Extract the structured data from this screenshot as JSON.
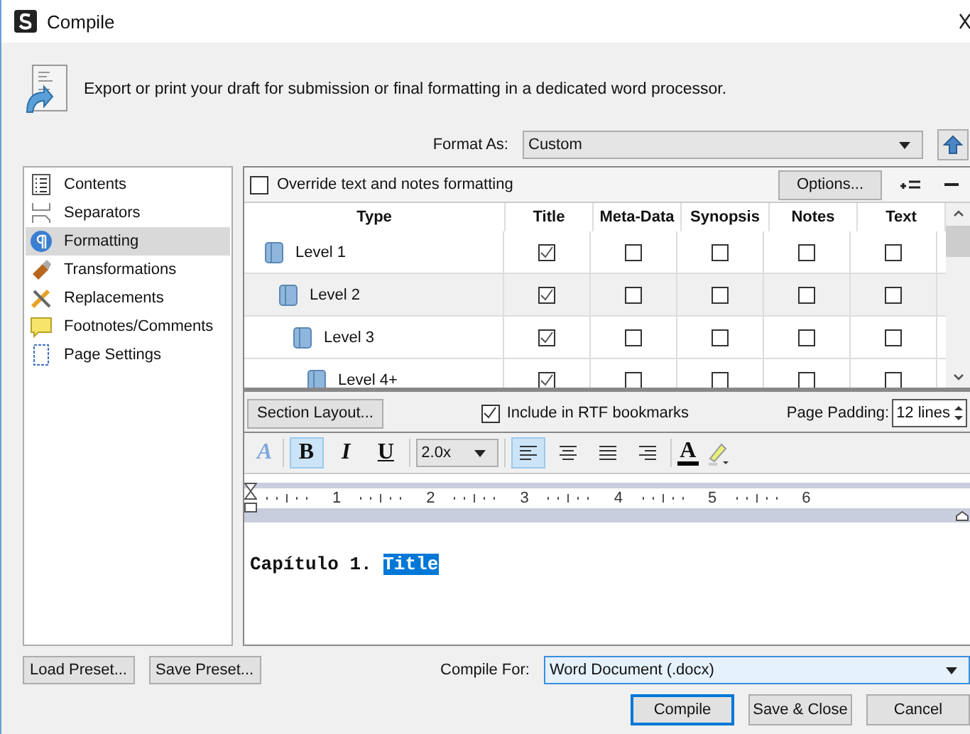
{
  "window": {
    "title": "Compile"
  },
  "header": {
    "description": "Export or print your draft for submission or final formatting in a dedicated word processor."
  },
  "format_as": {
    "label": "Format As:",
    "value": "Custom"
  },
  "sidebar": {
    "items": [
      {
        "label": "Contents",
        "selected": false
      },
      {
        "label": "Separators",
        "selected": false
      },
      {
        "label": "Formatting",
        "selected": true
      },
      {
        "label": "Transformations",
        "selected": false
      },
      {
        "label": "Replacements",
        "selected": false
      },
      {
        "label": "Footnotes/Comments",
        "selected": false
      },
      {
        "label": "Page Settings",
        "selected": false
      }
    ]
  },
  "override": {
    "label": "Override text and notes formatting",
    "checked": false
  },
  "options_button": "Options...",
  "table": {
    "columns": [
      "Type",
      "Title",
      "Meta-Data",
      "Synopsis",
      "Notes",
      "Text"
    ],
    "rows": [
      {
        "type": "Level 1",
        "selected": false,
        "checks": [
          true,
          false,
          false,
          false,
          false
        ]
      },
      {
        "type": "Level 2",
        "selected": true,
        "checks": [
          true,
          false,
          false,
          false,
          false
        ]
      },
      {
        "type": "Level 3",
        "selected": false,
        "checks": [
          true,
          false,
          false,
          false,
          false
        ]
      },
      {
        "type": "Level 4+",
        "selected": false,
        "checks": [
          true,
          false,
          false,
          false,
          false
        ]
      }
    ]
  },
  "section_bar": {
    "layout_button": "Section Layout...",
    "bookmarks": {
      "label": "Include in RTF bookmarks",
      "checked": true
    },
    "padding_label": "Page Padding:",
    "padding_value": "12 lines"
  },
  "toolbar": {
    "style_glyph": "A",
    "bold": {
      "label": "B",
      "on": true
    },
    "italic": {
      "label": "I",
      "on": false
    },
    "underline": {
      "label": "U",
      "on": false
    },
    "spacing": "2.0x",
    "alignments": [
      {
        "kind": "left",
        "selected": true
      },
      {
        "kind": "center",
        "selected": false
      },
      {
        "kind": "justify",
        "selected": false
      },
      {
        "kind": "right",
        "selected": false
      }
    ],
    "color_glyph": "A"
  },
  "ruler": [
    "1",
    "2",
    "3",
    "4",
    "5",
    "6"
  ],
  "editor": {
    "parts": [
      {
        "text": "Capítulo 1. ",
        "selected": false
      },
      {
        "text": "Title",
        "selected": true
      }
    ]
  },
  "presets": [
    "Load Preset...",
    "Save Preset..."
  ],
  "compile_for": {
    "label": "Compile For:",
    "value": "Word Document (.docx)"
  },
  "buttons": [
    "Compile",
    "Save & Close",
    "Cancel"
  ]
}
